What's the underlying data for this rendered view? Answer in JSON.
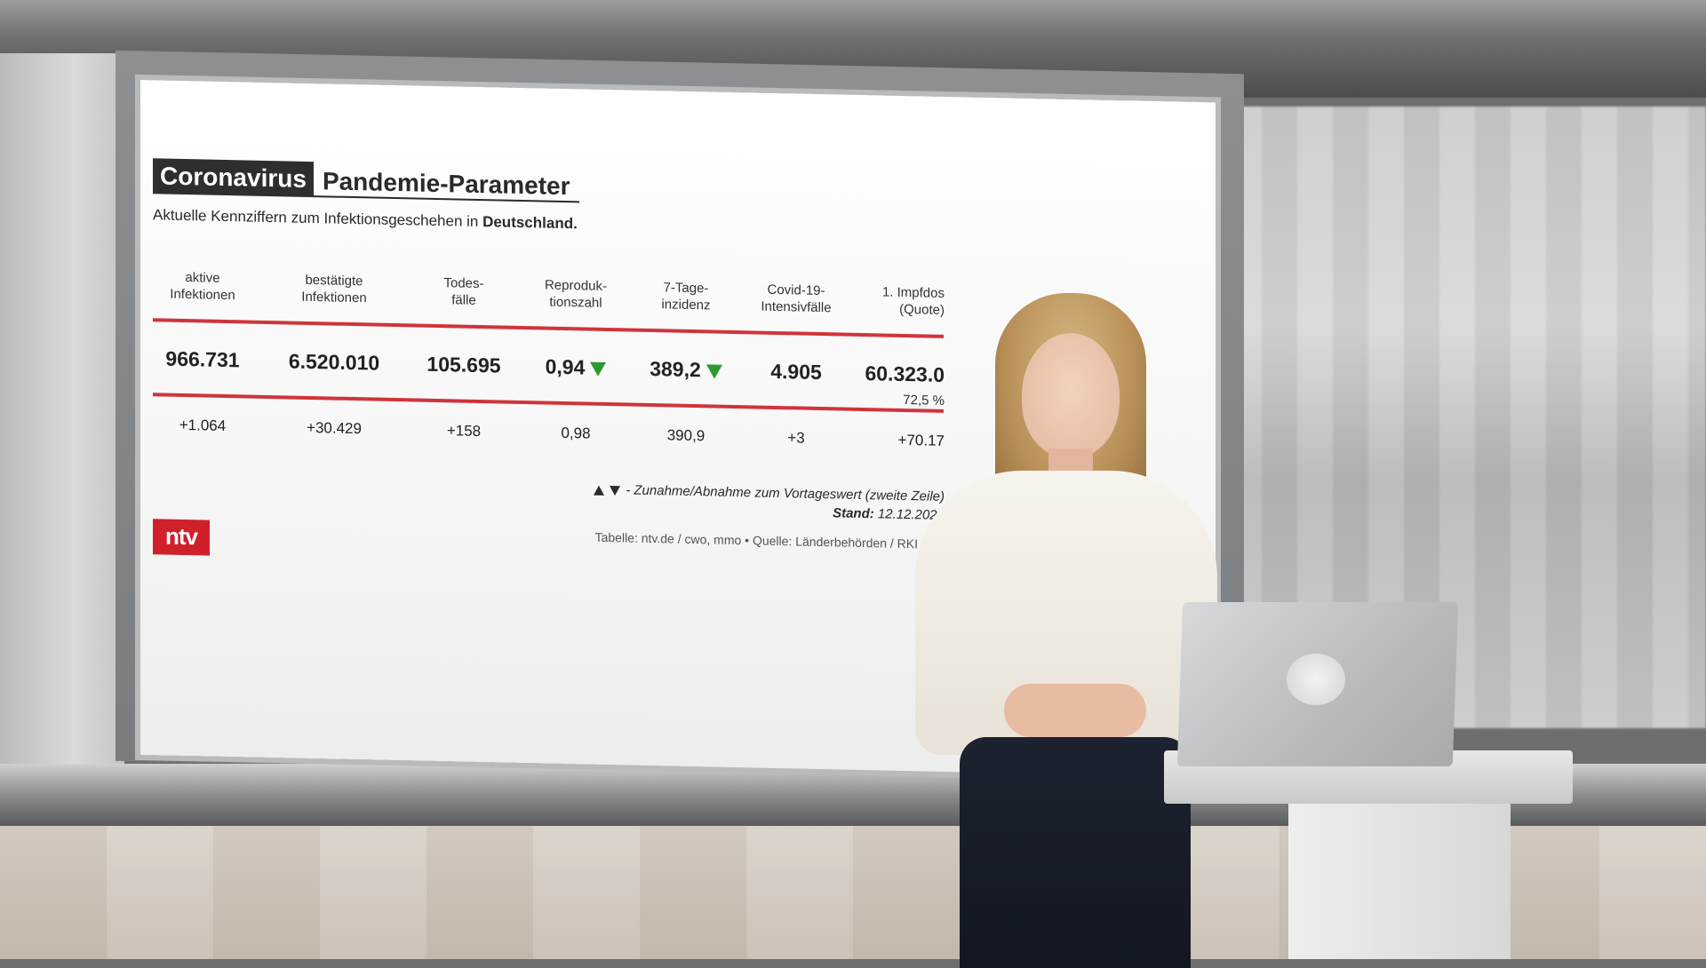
{
  "graphic": {
    "tag": "Coronavirus",
    "title": "Pandemie-Parameter",
    "subtitle_prefix": "Aktuelle Kennziffern zum Infektionsgeschehen in ",
    "subtitle_bold": "Deutschland.",
    "columns": [
      {
        "header_line1": "aktive",
        "header_line2": "Infektionen",
        "value": "966.731",
        "previous": "+1.064"
      },
      {
        "header_line1": "bestätigte",
        "header_line2": "Infektionen",
        "value": "6.520.010",
        "previous": "+30.429"
      },
      {
        "header_line1": "Todes-",
        "header_line2": "fälle",
        "value": "105.695",
        "previous": "+158"
      },
      {
        "header_line1": "Reproduk-",
        "header_line2": "tionszahl",
        "value": "0,94",
        "trend": "down",
        "previous": "0,98"
      },
      {
        "header_line1": "7-Tage-",
        "header_line2": "inzidenz",
        "value": "389,2",
        "trend": "down",
        "previous": "390,9"
      },
      {
        "header_line1": "Covid-19-",
        "header_line2": "Intensivfälle",
        "value": "4.905",
        "previous": "+3"
      },
      {
        "header_line1": "1. Impfdos",
        "header_line2": "(Quote)",
        "value": "60.323.0",
        "sub_value": "72,5 %",
        "previous": "+70.17"
      }
    ],
    "legend_text": "- Zunahme/Abnahme zum Vortageswert (zweite Zeile)",
    "stand_label": "Stand:",
    "stand_date": "12.12.2021",
    "source": "Tabelle: ntv.de / cwo, mmo • Quelle: Länderbehörden / RKI / DIV",
    "logo": "ntv",
    "colors": {
      "accent_red": "#d0343b",
      "trend_green": "#2d9a2d",
      "tag_bg": "#2e2e2e"
    },
    "icons": [
      "up-triangle-icon",
      "down-triangle-icon"
    ]
  }
}
